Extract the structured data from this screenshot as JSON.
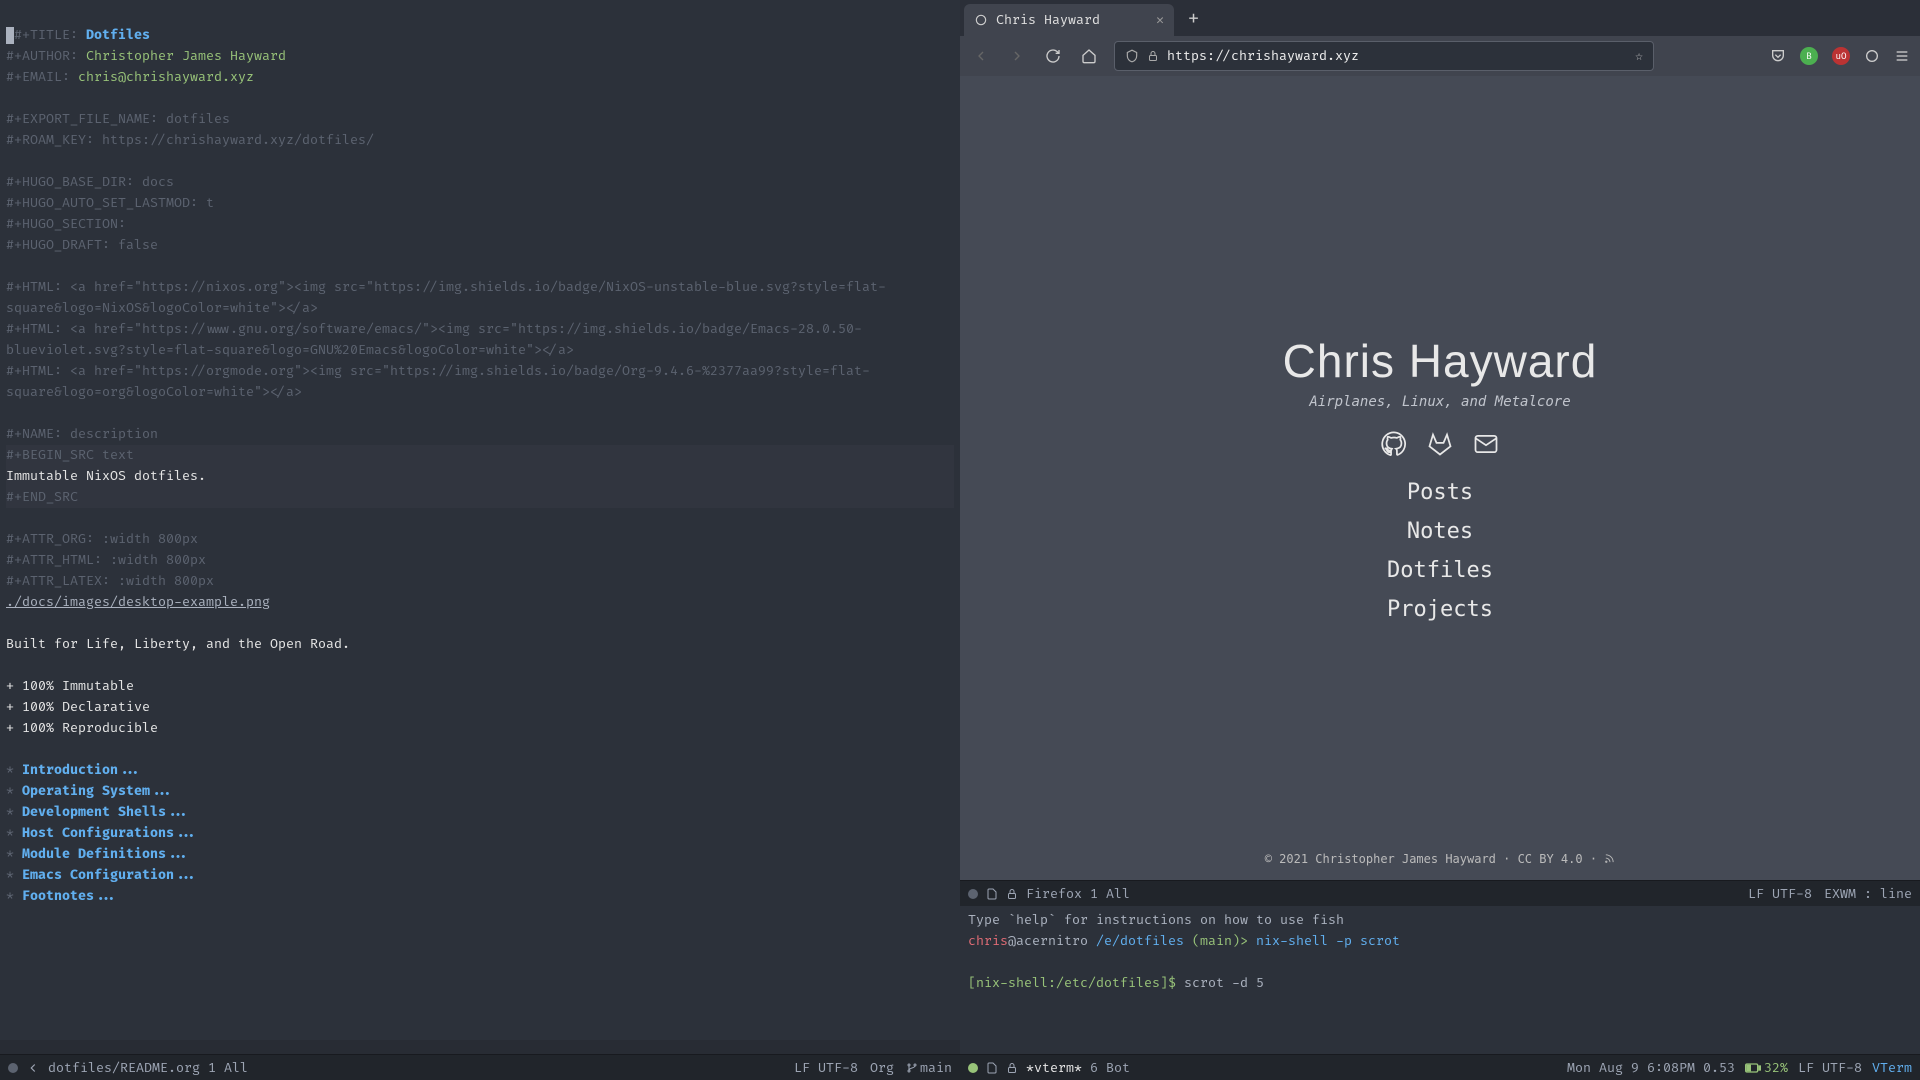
{
  "editor": {
    "title_key": "#+TITLE:",
    "title_val": "Dotfiles",
    "author_key": "#+AUTHOR:",
    "author_val": "Christopher James Hayward",
    "email_key": "#+EMAIL:",
    "email_val": "chris@chrishayward.xyz",
    "export_line": "#+EXPORT_FILE_NAME: dotfiles",
    "roam_line": "#+ROAM_KEY: https://chrishayward.xyz/dotfiles/",
    "hugo1": "#+HUGO_BASE_DIR: docs",
    "hugo2": "#+HUGO_AUTO_SET_LASTMOD: t",
    "hugo3": "#+HUGO_SECTION:",
    "hugo4": "#+HUGO_DRAFT: false",
    "html1": "#+HTML: <a href=\"https://nixos.org\"><img src=\"https://img.shields.io/badge/NixOS-unstable-blue.svg?style=flat-square&logo=NixOS&logoColor=white\"></a>",
    "html2": "#+HTML: <a href=\"https://www.gnu.org/software/emacs/\"><img src=\"https://img.shields.io/badge/Emacs-28.0.50-blueviolet.svg?style=flat-square&logo=GNU%20Emacs&logoColor=white\"></a>",
    "html3": "#+HTML: <a href=\"https://orgmode.org\"><img src=\"https://img.shields.io/badge/Org-9.4.6-%2377aa99?style=flat-square&logo=org&logoColor=white\"></a>",
    "name_line": "#+NAME: description",
    "begin_src": "#+BEGIN_SRC text",
    "src_body": "Immutable NixOS dotfiles.",
    "end_src": "#+END_SRC",
    "attr1": "#+ATTR_ORG: :width 800px",
    "attr2": "#+ATTR_HTML: :width 800px",
    "attr3": "#+ATTR_LATEX: :width 800px",
    "img_link": "./docs/images/desktop-example.png",
    "tagline": "Built for Life, Liberty, and the Open Road.",
    "bullet1": "+ 100% Immutable",
    "bullet2": "+ 100% Declarative",
    "bullet3": "+ 100% Reproducible",
    "h1": "Introduction...",
    "h2": "Operating System...",
    "h3": "Development Shells...",
    "h4": "Host Configurations...",
    "h5": "Module Definitions...",
    "h6": "Emacs Configuration...",
    "h7": "Footnotes..."
  },
  "left_modeline": {
    "buffer": "dotfiles/README.org",
    "pos": "1",
    "perc": "All",
    "encoding": "LF UTF-8",
    "mode": "Org",
    "branch": "main"
  },
  "browser": {
    "tab_title": "Chris Hayward",
    "url": "https://chrishayward.xyz",
    "page_title": "Chris Hayward",
    "subtitle": "Airplanes, Linux, and Metalcore",
    "nav": [
      "Posts",
      "Notes",
      "Dotfiles",
      "Projects"
    ],
    "footer": "© 2021 Christopher James Hayward · CC BY 4.0 · "
  },
  "ff_modeline": {
    "buffer": "Firefox",
    "pos": "1",
    "perc": "All",
    "encoding": "LF UTF-8",
    "mode": "EXWM : line"
  },
  "term": {
    "help": "Type `help` for instructions on how to use fish",
    "user": "chris",
    "host": "@acernitro",
    "path": "/e/dotfiles",
    "branch": "(main)>",
    "cmd1": "nix-shell -p scrot",
    "prompt2": "[nix-shell:/etc/dotfiles]$",
    "cmd2": "scrot -d 5"
  },
  "term_modeline": {
    "buffer": "*vterm*",
    "pos": "6",
    "perc": "Bot",
    "datetime": "Mon Aug  9 6:08PM 0.53",
    "battery": "32%",
    "encoding": "LF UTF-8",
    "mode": "VTerm"
  }
}
